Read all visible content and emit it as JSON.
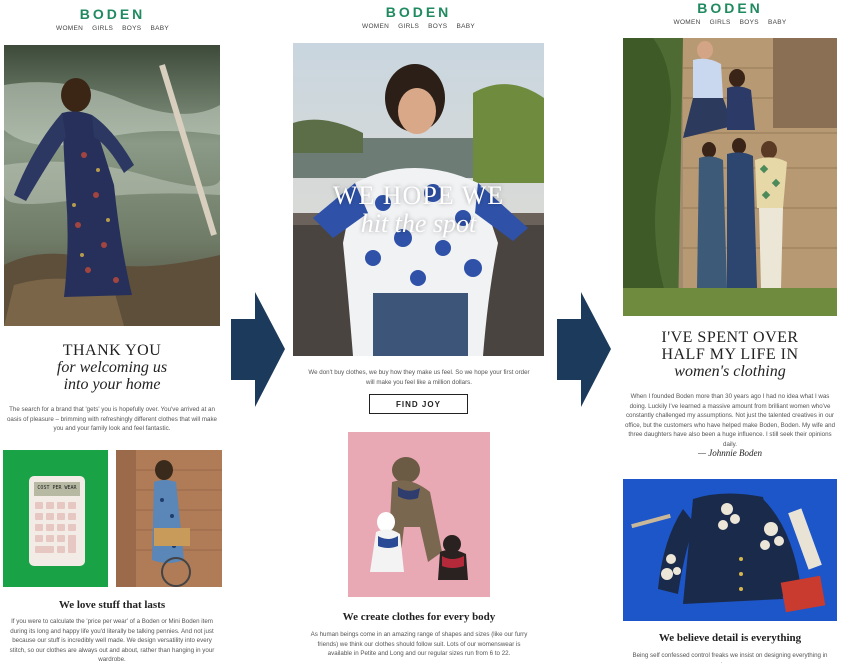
{
  "brand": "BODEN",
  "nav": [
    "WOMEN",
    "GIRLS",
    "BOYS",
    "BABY"
  ],
  "email1": {
    "headline_line1": "THANK YOU",
    "headline_line2": "for welcoming us",
    "headline_line3": "into your home",
    "body": "The search for a brand that 'gets' you is hopefully over. You've arrived at an oasis of pleasure – brimming with refreshingly different clothes that will make you and your family look and feel fantastic.",
    "calculator_display": "COST PER WEAR",
    "subhead": "We love stuff that lasts",
    "body2": "If you were to calculate the 'price per wear' of a Boden or Mini Boden item during its long and happy life you'd literally be talking pennies. And not just because our stuff is incredibly well made. We design versatility into every stitch, so our clothes are always out and about, rather than hanging in your wardrobe."
  },
  "email2": {
    "overlay_line1": "WE HOPE WE",
    "overlay_line2": "hit the spot",
    "body": "We don't buy clothes, we buy how they make us feel. So we hope your first order will make you feel like a million dollars.",
    "cta": "FIND JOY",
    "subhead": "We create clothes for every body",
    "body2": "As human beings come in an amazing range of shapes and sizes (like our furry friends) we think our clothes should follow suit. Lots of our womenswear is available in Petite and Long and our regular sizes run from 6 to 22."
  },
  "email3": {
    "headline_line1": "I'VE SPENT OVER",
    "headline_line2": "HALF MY LIFE IN",
    "headline_line3": "women's clothing",
    "body": "When I founded Boden more than 30 years ago I had no idea what I was doing. Luckily I've learned a massive amount from brilliant women who've constantly challenged my assumptions. Not just the talented creatives in our office, but the customers who have helped make Boden, Boden. My wife and three daughters have also been a huge influence. I still seek their opinions daily.",
    "signature": "Johnnie Boden",
    "subhead": "We believe detail is everything",
    "body2": "Being self confessed control freaks we insist on designing everything in house:"
  },
  "colors": {
    "brand_green": "#1f8a5f",
    "arrow_navy": "#1c3a5c",
    "green_bg": "#1aa246",
    "pink_bg": "#e8a8b4",
    "blue_bg": "#1d56c9"
  }
}
